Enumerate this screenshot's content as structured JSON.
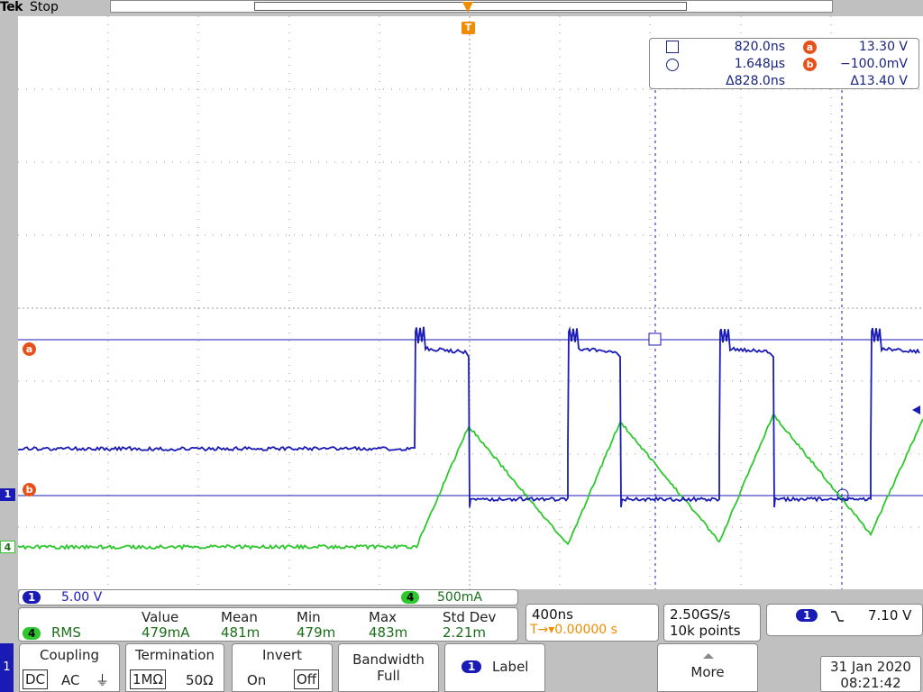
{
  "header": {
    "brand": "Tek",
    "run_state": "Stop",
    "trigger_marker": "T"
  },
  "cursors": {
    "cursor1_time": "820.0ns",
    "cursor2_time": "1.648µs",
    "delta_time": "Δ828.0ns",
    "a_label": "a",
    "b_label": "b",
    "a_value": "13.30 V",
    "b_value": "−100.0mV",
    "delta_value": "Δ13.40 V"
  },
  "markers": {
    "a": "a",
    "b": "b",
    "ch1": "1",
    "ch4": "4"
  },
  "channel_scale": {
    "ch1_num": "1",
    "ch1_scale": "5.00 V",
    "ch4_num": "4",
    "ch4_scale": "500mA"
  },
  "measurement": {
    "channel": "4",
    "type": "RMS",
    "headers": [
      "Value",
      "Mean",
      "Min",
      "Max",
      "Std Dev"
    ],
    "values": [
      "479mA",
      "481m",
      "479m",
      "483m",
      "2.21m"
    ]
  },
  "timebase": {
    "scale": "400ns",
    "trigger_pos": "T→▾0.00000 s"
  },
  "acquisition": {
    "rate": "2.50GS/s",
    "points": "10k points"
  },
  "trigger": {
    "channel": "1",
    "slope_icon": "falling-edge",
    "level": "7.10 V"
  },
  "menu": {
    "side_tab": "1",
    "coupling": {
      "title": "Coupling",
      "options": [
        "DC",
        "AC",
        "⏚"
      ],
      "selected": "DC"
    },
    "termination": {
      "title": "Termination",
      "options": [
        "1MΩ",
        "50Ω"
      ],
      "selected": "1MΩ"
    },
    "invert": {
      "title": "Invert",
      "options": [
        "On",
        "Off"
      ],
      "selected": "Off"
    },
    "bandwidth": {
      "title": "Bandwidth",
      "value": "Full"
    },
    "label": {
      "ch": "1",
      "title": "Label"
    },
    "more": {
      "title": "More"
    }
  },
  "datetime": {
    "date": "31 Jan  2020",
    "time": "08:21:42"
  },
  "colors": {
    "ch1": "#1a1ab4",
    "ch4": "#2ec82e",
    "cursor": "#e8501a",
    "trigger": "#f08c00"
  }
}
